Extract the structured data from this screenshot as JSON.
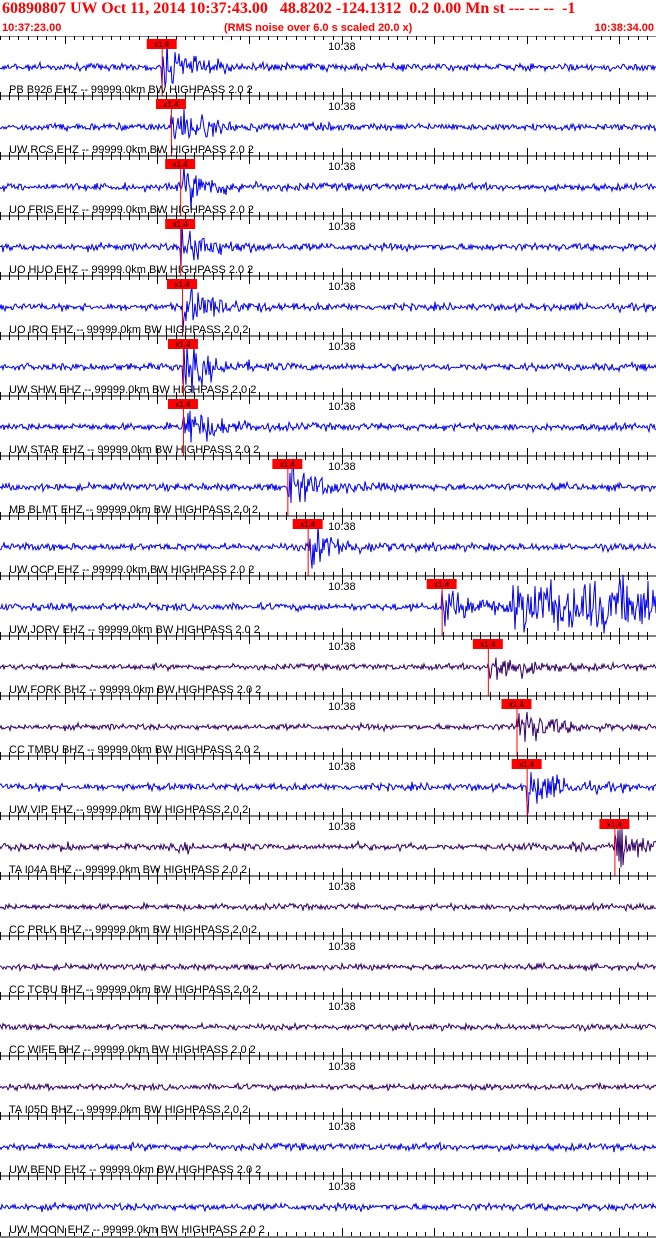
{
  "header": {
    "title": "60890807 UW Oct 11, 2014 10:37:43.00   48.8202 -124.1312  0.2 0.00 Mn st --- -- --  -1",
    "start_time": "10:37:23.00",
    "noise_note": "(RMS noise over 6.0 s scaled 20.0 x)",
    "end_time": "10:38:34.00"
  },
  "colors": {
    "header_text": "#ff0000",
    "trace_ehz": "#0000ee",
    "trace_bhz": "#330066",
    "pick_marker": "#ff0000",
    "grid": "#000000"
  },
  "chart_data": {
    "type": "line",
    "x_unit": "time",
    "x_range": [
      "10:37:23.00",
      "10:38:34.00"
    ],
    "x_tick_label": "10:38",
    "pick_label": "x1.4",
    "traces": [
      {
        "label": "PB B926 EHZ -- 99999.0km BW  HIGHPASS  2.0  2",
        "channel": "EHZ",
        "pick_time_s": 17.5
      },
      {
        "label": "UW RCS EHZ -- 99999.0km BW  HIGHPASS  2.0  2",
        "channel": "EHZ",
        "pick_time_s": 18.5
      },
      {
        "label": "UO FRIS EHZ -- 99999.0km BW  HIGHPASS  2.0  2",
        "channel": "EHZ",
        "pick_time_s": 19.5
      },
      {
        "label": "UO HUO EHZ -- 99999.0km BW  HIGHPASS  2.0  2",
        "channel": "EHZ",
        "pick_time_s": 19.5
      },
      {
        "label": "UO IRO EHZ -- 99999.0km BW  HIGHPASS  2.0  2",
        "channel": "EHZ",
        "pick_time_s": 19.7
      },
      {
        "label": "UW SHW EHZ -- 99999.0km BW  HIGHPASS  2.0  2",
        "channel": "EHZ",
        "pick_time_s": 19.8
      },
      {
        "label": "UW STAR EHZ -- 99999.0km BW  HIGHPASS  2.0  2",
        "channel": "EHZ",
        "pick_time_s": 19.8
      },
      {
        "label": "MB BLMT EHZ -- 99999.0km BW  HIGHPASS  2.0  2",
        "channel": "EHZ",
        "pick_time_s": 31.1
      },
      {
        "label": "UW OCP EHZ -- 99999.0km BW  HIGHPASS  2.0  2",
        "channel": "EHZ",
        "pick_time_s": 33.3
      },
      {
        "label": "UW JORV EHZ -- 99999.0km BW  HIGHPASS  2.0  2",
        "channel": "EHZ",
        "pick_time_s": 47.8
      },
      {
        "label": "UW FORK BHZ -- 99999.0km BW  HIGHPASS  2.0  2",
        "channel": "BHZ",
        "pick_time_s": 52.8
      },
      {
        "label": "CC TMBU BHZ -- 99999.0km BW  HIGHPASS  2.0  2",
        "channel": "BHZ",
        "pick_time_s": 55.9
      },
      {
        "label": "UW VIP EHZ -- 99999.0km BW  HIGHPASS  2.0  2",
        "channel": "EHZ",
        "pick_time_s": 57.0
      },
      {
        "label": "TA I04A BHZ -- 99999.0km BW  HIGHPASS  2.0  2",
        "channel": "BHZ",
        "pick_time_s": 66.5
      },
      {
        "label": "CC PRLK BHZ -- 99999.0km BW  HIGHPASS  2.0  2",
        "channel": "BHZ",
        "pick_time_s": null
      },
      {
        "label": "CC TCBU BHZ -- 99999.0km BW  HIGHPASS  2.0  2",
        "channel": "BHZ",
        "pick_time_s": null
      },
      {
        "label": "CC WIFE BHZ -- 99999.0km BW  HIGHPASS  2.0  2",
        "channel": "BHZ",
        "pick_time_s": null
      },
      {
        "label": "TA I05D BHZ -- 99999.0km BW  HIGHPASS  2.0  2",
        "channel": "BHZ",
        "pick_time_s": null
      },
      {
        "label": "UW BEND EHZ -- 99999.0km BW  HIGHPASS  2.0  2",
        "channel": "EHZ",
        "pick_time_s": null
      },
      {
        "label": "UW MOON EHZ -- 99999.0km BW  HIGHPASS  2.0  2",
        "channel": "EHZ",
        "pick_time_s": null
      }
    ]
  }
}
